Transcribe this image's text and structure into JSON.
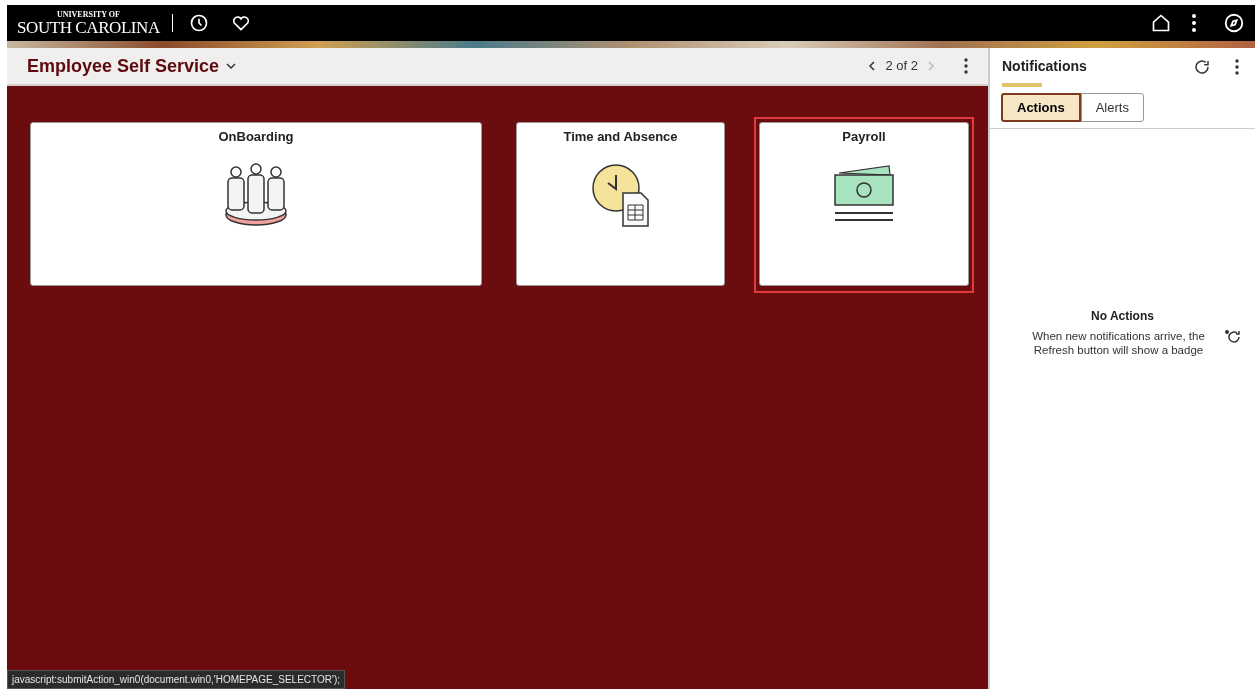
{
  "header": {
    "logo_top": "UNIVERSITY OF",
    "logo_bottom": "SOUTH CAROLINA"
  },
  "homepage": {
    "title": "Employee Self Service",
    "pager": "2 of 2"
  },
  "tiles": [
    {
      "title": "OnBoarding",
      "kind": "people",
      "highlighted": false
    },
    {
      "title": "Time and Absence",
      "kind": "clock",
      "highlighted": false
    },
    {
      "title": "Payroll",
      "kind": "money",
      "highlighted": true
    }
  ],
  "notifications": {
    "title": "Notifications",
    "tabs": [
      {
        "label": "Actions",
        "selected": true
      },
      {
        "label": "Alerts",
        "selected": false
      }
    ],
    "empty_title": "No Actions",
    "empty_text": "When new notifications arrive, the Refresh button will show a badge"
  },
  "status_bar": "javascript:submitAction_win0(document.win0,'HOMEPAGE_SELECTOR');"
}
